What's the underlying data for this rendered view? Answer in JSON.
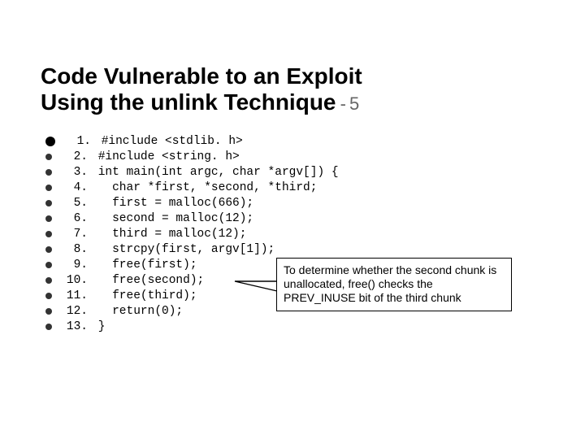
{
  "title_line1": "Code Vulnerable to an Exploit",
  "title_line2": "Using the unlink Technique",
  "title_tail": " - 5",
  "colors": {
    "bullet_first": "#000000",
    "bullet_rest": "#333333"
  },
  "code": [
    {
      "n": " 1.",
      "t": " #include <stdlib. h>"
    },
    {
      "n": " 2.",
      "t": " #include <string. h>"
    },
    {
      "n": " 3.",
      "t": " int main(int argc, char *argv[]) {"
    },
    {
      "n": " 4.",
      "t": "   char *first, *second, *third;"
    },
    {
      "n": " 5.",
      "t": "   first = malloc(666);"
    },
    {
      "n": " 6.",
      "t": "   second = malloc(12);"
    },
    {
      "n": " 7.",
      "t": "   third = malloc(12);"
    },
    {
      "n": " 8.",
      "t": "   strcpy(first, argv[1]);"
    },
    {
      "n": " 9.",
      "t": "   free(first);"
    },
    {
      "n": "10.",
      "t": "   free(second);"
    },
    {
      "n": "11.",
      "t": "   free(third);"
    },
    {
      "n": "12.",
      "t": "   return(0);"
    },
    {
      "n": "13.",
      "t": " }"
    }
  ],
  "callout": "To determine whether the second chunk is unallocated, free() checks the PREV_INUSE bit of the third chunk"
}
